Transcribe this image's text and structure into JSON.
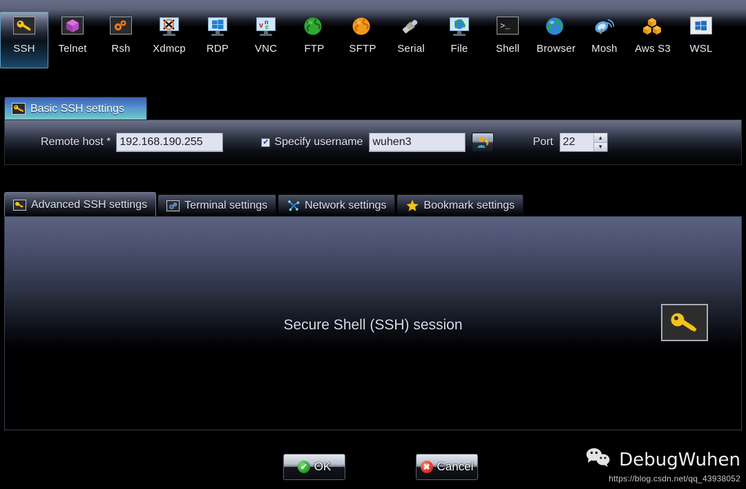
{
  "toolbar": {
    "items": [
      {
        "label": "SSH",
        "icon": "key-icon",
        "selected": true
      },
      {
        "label": "Telnet",
        "icon": "purple-cube-icon",
        "selected": false
      },
      {
        "label": "Rsh",
        "icon": "orange-gears-icon",
        "selected": false
      },
      {
        "label": "Xdmcp",
        "icon": "x-monitor-icon",
        "selected": false
      },
      {
        "label": "RDP",
        "icon": "windows-monitor-icon",
        "selected": false
      },
      {
        "label": "VNC",
        "icon": "vnc-monitor-icon",
        "selected": false
      },
      {
        "label": "FTP",
        "icon": "green-globe-icon",
        "selected": false
      },
      {
        "label": "SFTP",
        "icon": "orange-globe-icon",
        "selected": false
      },
      {
        "label": "Serial",
        "icon": "plug-icon",
        "selected": false
      },
      {
        "label": "File",
        "icon": "globe-monitor-icon",
        "selected": false
      },
      {
        "label": "Shell",
        "icon": "terminal-prompt-icon",
        "selected": false
      },
      {
        "label": "Browser",
        "icon": "blue-globe-icon",
        "selected": false
      },
      {
        "label": "Mosh",
        "icon": "satellite-dish-icon",
        "selected": false
      },
      {
        "label": "Aws S3",
        "icon": "aws-cubes-icon",
        "selected": false
      },
      {
        "label": "WSL",
        "icon": "windows-logo-icon",
        "selected": false
      }
    ]
  },
  "basic_settings": {
    "tab_label": "Basic SSH settings",
    "tab_icon": "key-icon",
    "remote_host_label": "Remote host *",
    "remote_host_value": "192.168.190.255",
    "specify_username_label": "Specify username",
    "specify_username_checked": true,
    "checkbox_mark": "✔",
    "username_value": "wuhen3",
    "user_browse_icon": "user-key-icon",
    "port_label": "Port",
    "port_value": "22",
    "spinner_up": "▲",
    "spinner_down": "▼"
  },
  "subtabs": [
    {
      "label": "Advanced SSH settings",
      "icon": "key-icon",
      "active": true
    },
    {
      "label": "Terminal settings",
      "icon": "gears-icon",
      "active": false
    },
    {
      "label": "Network settings",
      "icon": "network-nodes-icon",
      "active": false
    },
    {
      "label": "Bookmark settings",
      "icon": "star-icon",
      "active": false
    }
  ],
  "main": {
    "title": "Secure Shell (SSH) session",
    "key_icon": "key-icon"
  },
  "buttons": {
    "ok_label": "OK",
    "ok_icon": "check-circle-icon",
    "cancel_label": "Cancel",
    "cancel_icon": "cross-circle-icon"
  },
  "watermark": {
    "name": "DebugWuhen",
    "url": "https://blog.csdn.net/qq_43938052",
    "icon": "wechat-icon"
  },
  "colors": {
    "accent_blue": "#5fa0c4",
    "panel_top": "#5b6280",
    "field_bg": "#dfe2ef",
    "key_yellow": "#f5c21b",
    "ok_green": "#1f9c1f",
    "cancel_red": "#e02b1d"
  }
}
